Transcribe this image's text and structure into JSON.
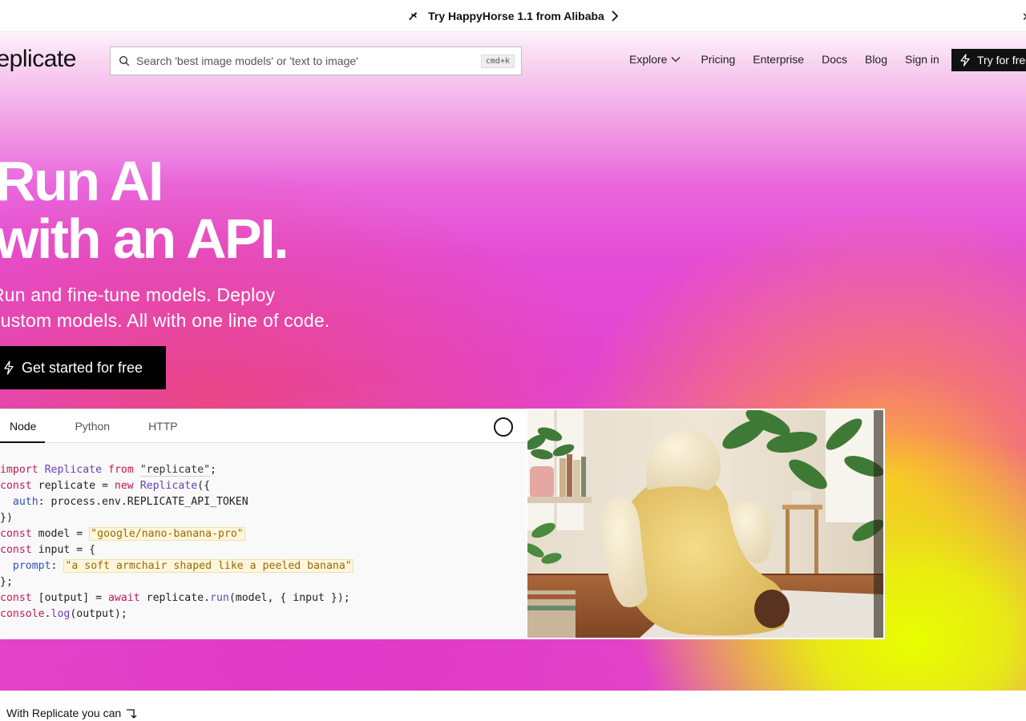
{
  "announcement": {
    "text": "Try HappyHorse 1.1 from Alibaba",
    "icon": "horse-icon",
    "close": "×"
  },
  "header": {
    "logo": "replicate",
    "search_placeholder": "Search 'best image models' or 'text to image'",
    "search_shortcut": "cmd+k",
    "nav": [
      "Explore",
      "Pricing",
      "Enterprise",
      "Docs",
      "Blog",
      "Sign in"
    ],
    "cta": "Try for free"
  },
  "hero": {
    "title_line1": "Run AI",
    "title_line2": "with an API.",
    "subtitle_line1": "Run and fine-tune models. Deploy",
    "subtitle_line2": "custom models. All with one line of code.",
    "cta": "Get started for free"
  },
  "code": {
    "tabs": [
      "Node",
      "Python",
      "HTTP"
    ],
    "active_tab": "Node",
    "model": "google/nano-banana-pro",
    "prompt": "a soft armchair shaped like a peeled banana"
  },
  "colors": {
    "accent_black": "#000000",
    "gradient_pink": "#e44dd6",
    "gradient_yellow": "#e8ff00"
  },
  "footer_teaser": {
    "text": "With Replicate you can"
  }
}
